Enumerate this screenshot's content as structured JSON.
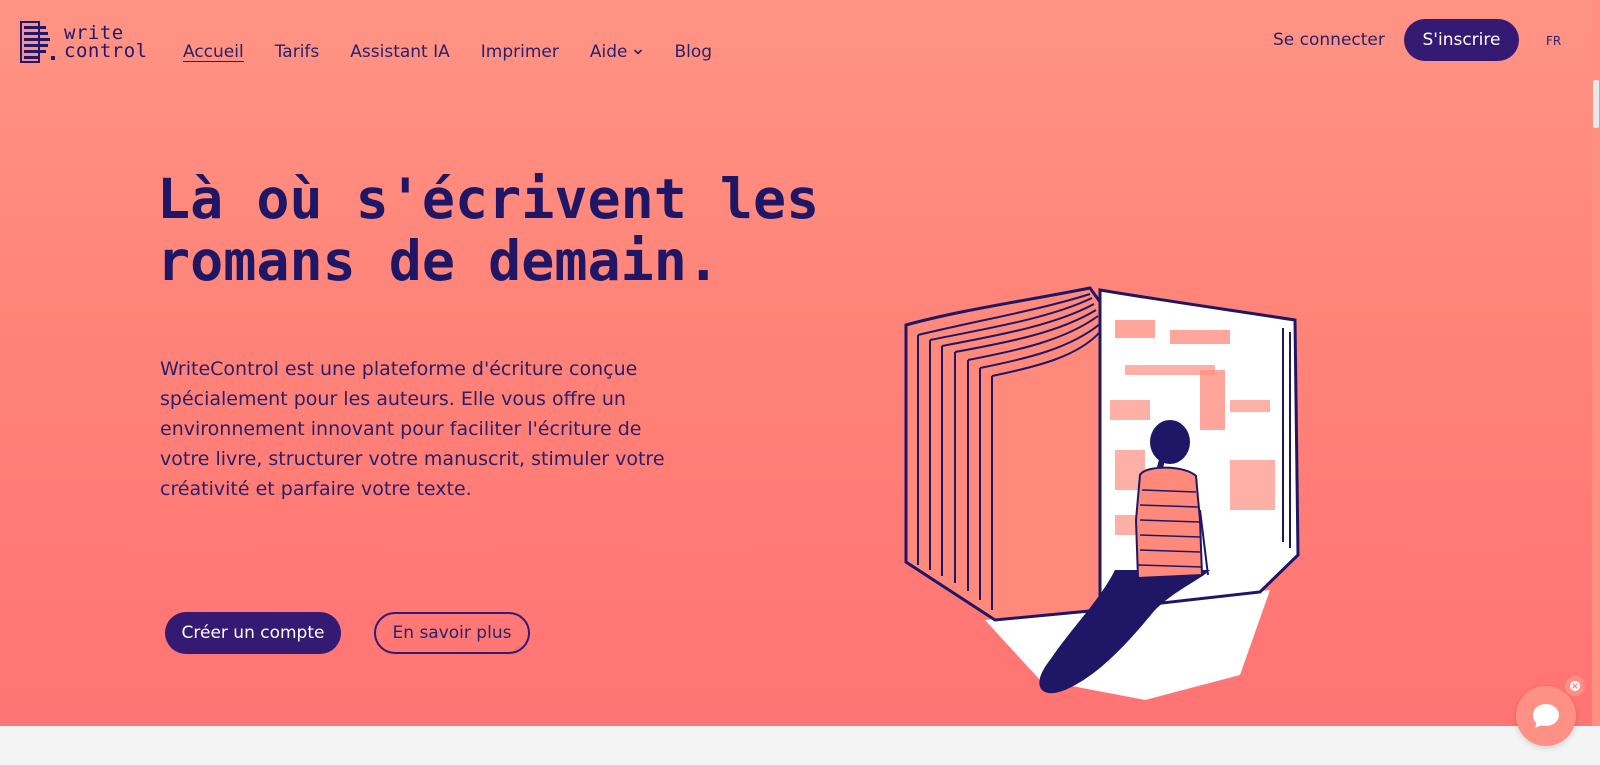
{
  "brand": {
    "line1": "write",
    "line2": "control",
    "icon": "writecontrol-logo-icon",
    "color": "#21186b"
  },
  "nav": {
    "items": [
      {
        "label": "Accueil",
        "active": true
      },
      {
        "label": "Tarifs"
      },
      {
        "label": "Assistant IA"
      },
      {
        "label": "Imprimer"
      },
      {
        "label": "Aide",
        "dropdown": true
      },
      {
        "label": "Blog"
      }
    ]
  },
  "header": {
    "login_label": "Se connecter",
    "signup_label": "S'inscrire",
    "lang_label": "FR"
  },
  "hero": {
    "title_line1": "Là où s'écrivent les",
    "title_line2": "romans de demain.",
    "lead": "WriteControl est une plateforme d'écriture conçue spécialement pour les auteurs. Elle vous offre un environnement innovant pour faciliter l'écriture de votre livre, structurer votre manuscrit, stimuler votre créativité et parfaire votre texte.",
    "cta_primary": "Créer un compte",
    "cta_secondary": "En savoir plus",
    "illustration_icon": "open-book-reader-illustration"
  },
  "chat": {
    "icon": "chat-bubble-icon",
    "close_icon": "close-icon"
  },
  "colors": {
    "accent": "#351a74",
    "text": "#2a1f69",
    "hero_top": "#ff9484",
    "hero_bottom": "#ff7474"
  }
}
